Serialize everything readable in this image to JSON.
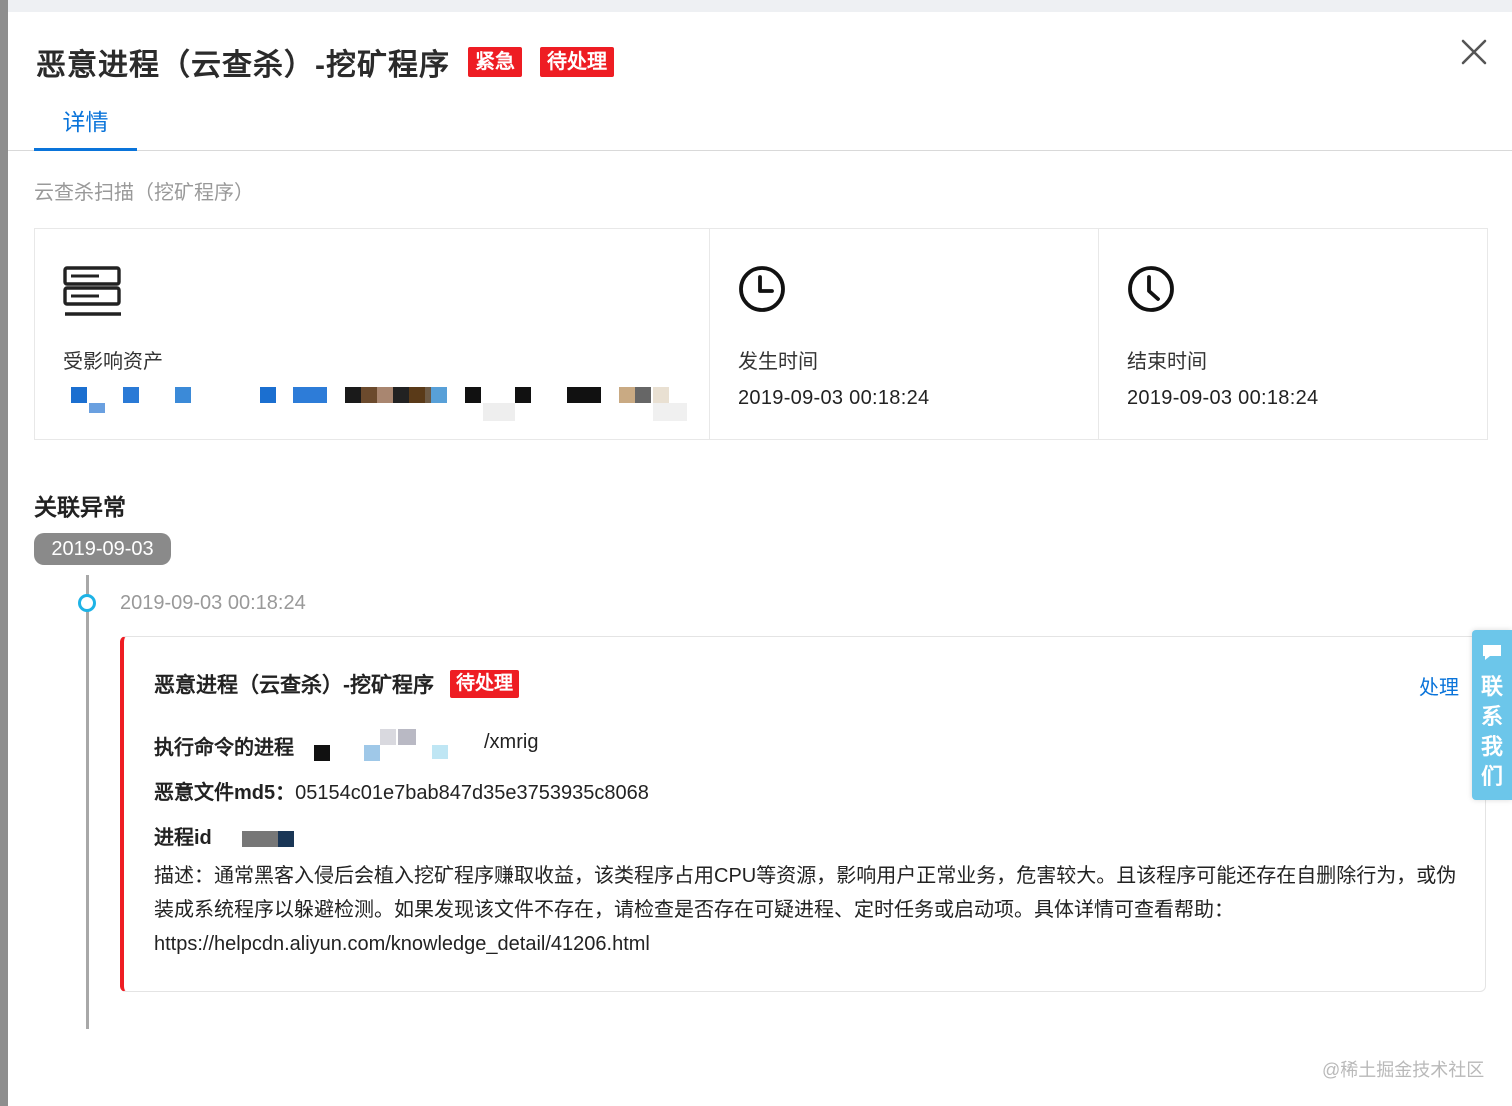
{
  "header": {
    "title": "恶意进程（云查杀）-挖矿程序",
    "tag_urgent": "紧急",
    "tag_status": "待处理",
    "close_icon": "close-icon"
  },
  "tabs": [
    {
      "label": "详情",
      "active": true
    }
  ],
  "section": {
    "subtitle": "云查杀扫描（挖矿程序）"
  },
  "cards": {
    "asset": {
      "icon": "server-icon",
      "label": "受影响资产"
    },
    "start": {
      "icon": "clock-icon",
      "label": "发生时间",
      "value": "2019-09-03 00:18:24"
    },
    "end": {
      "icon": "clock-icon",
      "label": "结束时间",
      "value": "2019-09-03 00:18:24"
    }
  },
  "related": {
    "title": "关联异常",
    "date_group": "2019-09-03",
    "event_time": "2019-09-03 00:18:24"
  },
  "event": {
    "title": "恶意进程（云查杀）-挖矿程序",
    "status": "待处理",
    "action": "处理",
    "process_label": "执行命令的进程",
    "process_suffix": "/xmrig",
    "md5_label": "恶意文件md5：",
    "md5_value": "05154c01e7bab847d35e3753935c8068",
    "pid_label": "进程id",
    "description": "描述：通常黑客入侵后会植入挖矿程序赚取收益，该类程序占用CPU等资源，影响用户正常业务，危害较大。且该程序可能还存在自删除行为，或伪装成系统程序以躲避检测。如果发现该文件不存在，请检查是否存在可疑进程、定时任务或启动项。具体详情可查看帮助：https://helpcdn.aliyun.com/knowledge_detail/41206.html"
  },
  "contact": {
    "label": "联系我们",
    "icon": "chat-icon"
  },
  "watermark": "@稀土掘金技术社区",
  "colors": {
    "accent": "#0a74da",
    "danger": "#ee1d23",
    "timeline_dot": "#1eb3e6",
    "contact_bg": "#6cc6ea"
  }
}
